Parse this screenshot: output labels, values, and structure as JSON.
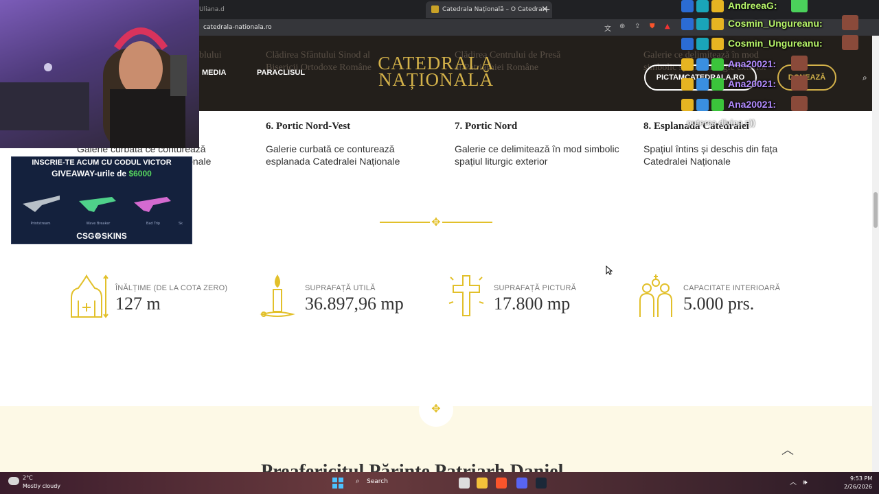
{
  "browser": {
    "prev_tab_label": "Uliana.d",
    "active_tab_title": "Catedrala Națională – O Catedral",
    "url": "catedrala-nationala.ro"
  },
  "header": {
    "ghost_texts": [
      "blului",
      "Clădirea Sfântului Sinod al",
      "Bisericii Ortodoxe Române",
      "Clădirea Centrului de Presă",
      "al Patriarhiei Române",
      "Galerie ce delimitează în mod",
      "simbolic spațiul liturgic exterior"
    ],
    "nav": [
      "MEDIA",
      "PARACLISUL"
    ],
    "logo_line1": "CATEDRALA",
    "logo_line2": "NAȚIONALĂ",
    "btn_pictam": "PICTAMCATEDRALA.RO",
    "btn_doneaza": "DONEAZĂ"
  },
  "portice": [
    {
      "title": "6. Portic Nord-Vest",
      "desc": "Galerie curbată ce conturează esplanada Catedralei Naționale"
    },
    {
      "title": "7. Portic Nord",
      "desc": "Galerie ce delimitează în mod simbolic spațiul liturgic exterior"
    },
    {
      "title": "8. Esplanada Catedralei",
      "desc": "Spațiul întins și deschis din fața Catedralei Naționale"
    }
  ],
  "left_partial_desc": "Galerie curbată ce conturează esplanada Catedralei Naționale",
  "stats": [
    {
      "label": "ÎNĂLȚIME (DE LA COTA ZERO)",
      "value": "127 m",
      "icon": "cathedral-height-icon"
    },
    {
      "label": "SUPRAFAȚĂ UTILĂ",
      "value": "36.897,96 mp",
      "icon": "candle-icon"
    },
    {
      "label": "SUPRAFAȚĂ PICTURĂ",
      "value": "17.800 mp",
      "icon": "cross-icon"
    },
    {
      "label": "CAPACITATE INTERIOARĂ",
      "value": "5.000 prs.",
      "icon": "people-icon"
    }
  ],
  "bottom_title": "Preafericitul Părinte Patriarh Daniel",
  "stream": {
    "ad_line1": "INSCRIE-TE ACUM CU CODUL VICTOR",
    "ad_line2_prefix": "GIVEAWAY-urile de ",
    "ad_amount": "$6000",
    "ad_skins": [
      "Printstream",
      "Wave Breaker",
      "Bad Trip",
      "Sk"
    ],
    "ad_brand": "CSG⚙SKINS",
    "chat": [
      {
        "name": "AndreeaG:",
        "purple": false
      },
      {
        "name": "Cosmin_Ungureanu:",
        "purple": false
      },
      {
        "name": "Cosmin_Ungureanu:",
        "purple": false
      },
      {
        "name": "Ana20021:",
        "purple": true
      },
      {
        "name": "Ana20021:",
        "purple": true
      },
      {
        "name": "Ana20021:",
        "purple": true
      }
    ],
    "chat_message": "puterea divina =))"
  },
  "taskbar": {
    "temp": "2°C",
    "weather": "Mostly cloudy",
    "search": "Search",
    "time": "9:53 PM",
    "date": "2/26/2026"
  },
  "colors": {
    "gold": "#d4b24a",
    "header_bg": "#231f1b",
    "cream": "#fdf9e6",
    "chat_green": "#b8f56a",
    "chat_purple": "#b28bff"
  }
}
